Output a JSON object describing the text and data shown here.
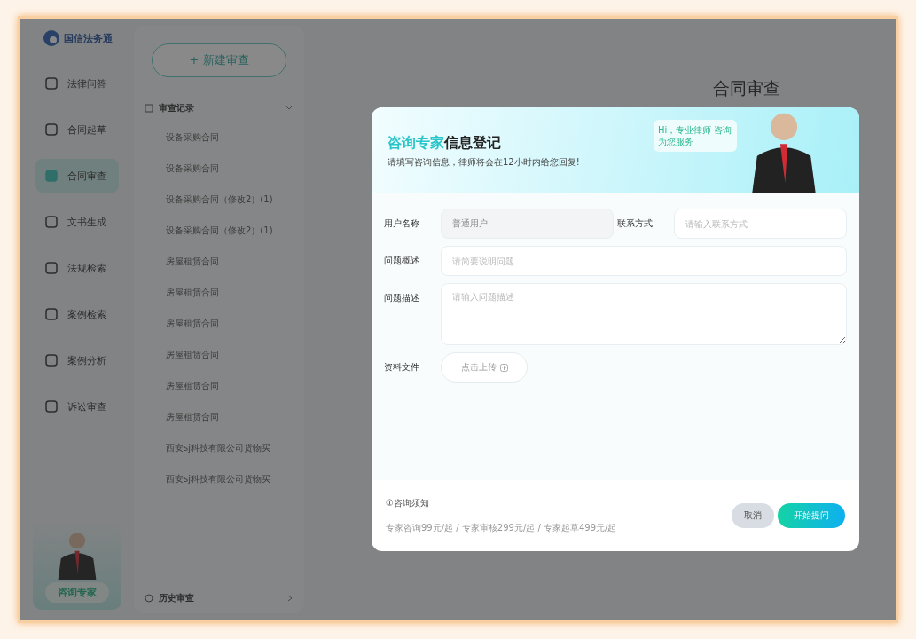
{
  "brand": {
    "name": "国信法务通"
  },
  "nav": [
    {
      "label": "法律问答",
      "selected": false
    },
    {
      "label": "合同起草",
      "selected": false
    },
    {
      "label": "合同审查",
      "selected": true
    },
    {
      "label": "文书生成",
      "selected": false
    },
    {
      "label": "法规检索",
      "selected": false
    },
    {
      "label": "案例检索",
      "selected": false
    },
    {
      "label": "案例分析",
      "selected": false
    },
    {
      "label": "诉讼审查",
      "selected": false
    }
  ],
  "expert_card": {
    "label": "咨询专家"
  },
  "records": {
    "new_button": "+ 新建审查",
    "section": "审查记录",
    "expanded": true,
    "items": [
      "设备采购合同",
      "设备采购合同",
      "设备采购合同（修改2）(1)",
      "设备采购合同（修改2）(1)",
      "房屋租赁合同",
      "房屋租赁合同",
      "房屋租赁合同",
      "房屋租赁合同",
      "房屋租赁合同",
      "房屋租赁合同",
      "西安sj科技有限公司货物买",
      "西安sj科技有限公司货物买"
    ],
    "history": "历史审查"
  },
  "main": {
    "title": "合同审查"
  },
  "dialog": {
    "title_accent": "咨询专家",
    "title": "信息登记",
    "subtitle": "请填写咨询信息，律师将会在12小时内给您回复!",
    "bubble": "Hi，专业律师 咨询为您服务",
    "fields": [
      {
        "label": "用户名称",
        "value": "普通用户",
        "disabled": true
      },
      {
        "label": "联系方式",
        "placeholder": "请输入联系方式",
        "disabled": false
      },
      {
        "label": "问题概述",
        "placeholder": "请简要说明问题",
        "disabled": false
      },
      {
        "label": "问题描述",
        "placeholder": "请输入问题描述",
        "disabled": false
      }
    ],
    "upload": {
      "label": "资料文件",
      "button": "点击上传"
    },
    "notice_title": "①咨询须知",
    "notice": "专家咨询99元/起 / 专家审核299元/起 / 专家起草499元/起",
    "cancel": "取消",
    "submit": "开始提问"
  }
}
